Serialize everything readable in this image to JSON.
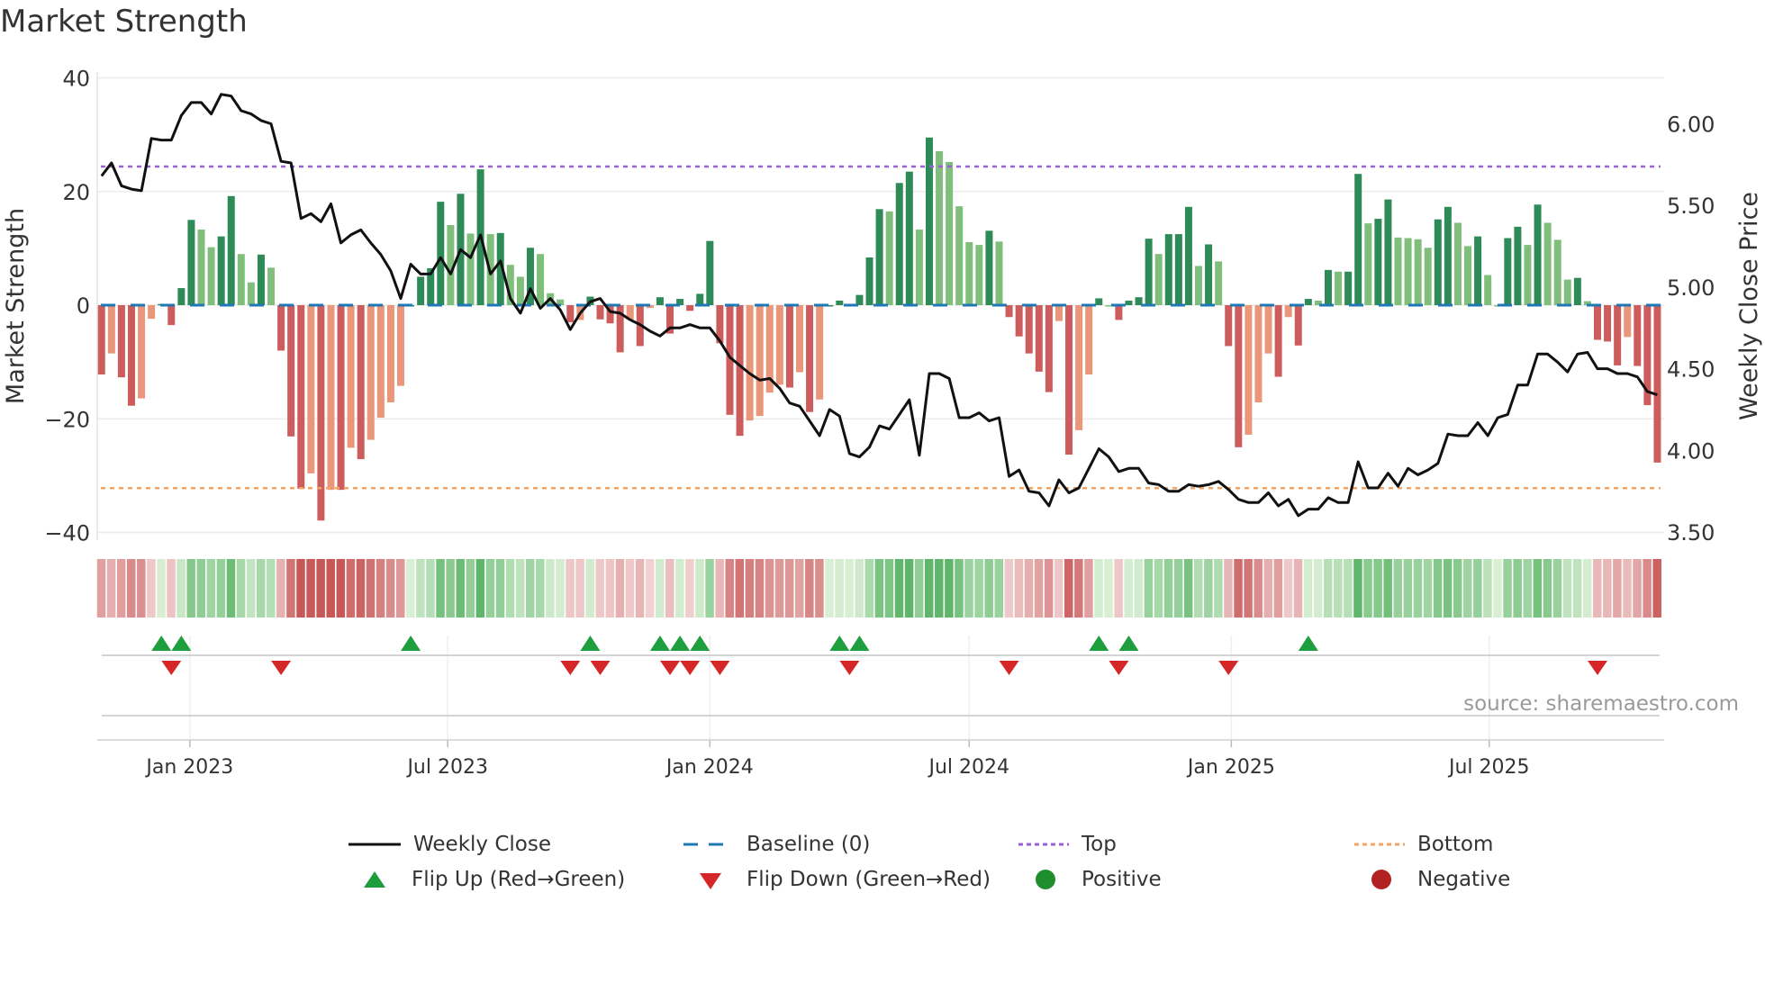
{
  "chart_data": {
    "type": "bar",
    "title": "Market Strength",
    "ylabel_left": "Market Strength",
    "ylabel_right": "Weekly Close Price",
    "ylim_left": [
      -40,
      40
    ],
    "ylim_right": [
      3.5,
      6.0
    ],
    "left_ticks": [
      "40",
      "20",
      "0",
      "−20",
      "−40"
    ],
    "left_tick_values": [
      40,
      20,
      0,
      -20,
      -40
    ],
    "right_ticks": [
      "6.00",
      "5.50",
      "5.00",
      "4.50",
      "4.00",
      "3.50"
    ],
    "right_tick_values": [
      6.0,
      5.5,
      5.0,
      4.5,
      4.0,
      3.5
    ],
    "x_ticks": [
      {
        "label": "Jan 2023",
        "date": "2023-01-01"
      },
      {
        "label": "Jul 2023",
        "date": "2023-07-01"
      },
      {
        "label": "Jan 2024",
        "date": "2024-01-01"
      },
      {
        "label": "Jul 2024",
        "date": "2024-07-01"
      },
      {
        "label": "Jan 2025",
        "date": "2025-01-01"
      },
      {
        "label": "Jul 2025",
        "date": "2025-07-01"
      }
    ],
    "start_date": "2022-10-31",
    "interval_days": 7,
    "top_level": 24.4,
    "bottom_level": -32.2,
    "baseline": 0,
    "strength": [
      -12.2,
      -8.5,
      -12.7,
      -17.7,
      -16.4,
      -2.4,
      0.2,
      -3.5,
      3,
      15,
      13.3,
      10.2,
      12.1,
      19.2,
      9,
      4,
      8.9,
      6.6,
      -8,
      -23.1,
      -32.3,
      -29.6,
      -37.9,
      -32.5,
      -32.5,
      -25.1,
      -27.1,
      -23.7,
      -19.8,
      -17.1,
      -14.2,
      0,
      5,
      6.5,
      18.2,
      14.1,
      19.6,
      12.6,
      23.9,
      12.5,
      12.7,
      7.1,
      5,
      10.1,
      9,
      2.1,
      1,
      -3,
      -2.6,
      1.5,
      -2.5,
      -3.2,
      -8.3,
      -2.5,
      -7.2,
      -0.5,
      1.4,
      -5,
      1.1,
      -1,
      2,
      11.3,
      -6.7,
      -19.3,
      -23,
      -20.3,
      -19.5,
      -15.4,
      -14,
      -14.5,
      -11.8,
      -18.8,
      -16.6,
      0,
      0.8,
      0,
      1.8,
      8.4,
      16.9,
      16.5,
      21.5,
      23.5,
      13.3,
      29.5,
      27.1,
      25.2,
      17.4,
      11.1,
      10.6,
      13.1,
      11.2,
      -2.1,
      -5.5,
      -8.5,
      -11.7,
      -15.3,
      -2.8,
      -26.3,
      -22,
      -12.2,
      1.2,
      0,
      -2.6,
      0.8,
      1.4,
      11.7,
      9,
      12.5,
      12.5,
      17.3,
      6.9,
      10.7,
      7.7,
      -7.2,
      -25,
      -22.8,
      -17.1,
      -8.5,
      -12.6,
      -2.1,
      -7.1,
      1.1,
      0.8,
      6.2,
      5.9,
      5.9,
      23.1,
      14.4,
      15.2,
      18.6,
      11.9,
      11.8,
      11.6,
      10.1,
      15.1,
      17.3,
      14.5,
      10.4,
      12.1,
      5.3,
      0,
      11.8,
      13.8,
      10.6,
      17.7,
      14.5,
      11.5,
      4.5,
      4.8,
      0.7,
      -6.1,
      -6.4,
      -10.6,
      -5.6,
      -10.7,
      -17.6,
      -27.7
    ],
    "weekly_close": [
      5.68,
      5.76,
      5.62,
      5.6,
      5.59,
      5.91,
      5.9,
      5.9,
      6.05,
      6.13,
      6.13,
      6.06,
      6.18,
      6.17,
      6.08,
      6.06,
      6.02,
      6.0,
      5.77,
      5.76,
      5.42,
      5.45,
      5.4,
      5.51,
      5.27,
      5.32,
      5.35,
      5.27,
      5.2,
      5.1,
      4.93,
      5.14,
      5.08,
      5.08,
      5.18,
      5.08,
      5.23,
      5.18,
      5.32,
      5.08,
      5.16,
      4.93,
      4.84,
      4.99,
      4.87,
      4.93,
      4.86,
      4.74,
      4.84,
      4.91,
      4.93,
      4.85,
      4.84,
      4.8,
      4.77,
      4.73,
      4.7,
      4.75,
      4.75,
      4.77,
      4.75,
      4.75,
      4.67,
      4.57,
      4.52,
      4.47,
      4.43,
      4.44,
      4.38,
      4.29,
      4.27,
      4.18,
      4.09,
      4.25,
      4.21,
      3.98,
      3.96,
      4.02,
      4.15,
      4.13,
      4.22,
      4.31,
      3.97,
      4.47,
      4.47,
      4.44,
      4.2,
      4.2,
      4.23,
      4.18,
      4.2,
      3.84,
      3.88,
      3.75,
      3.74,
      3.66,
      3.82,
      3.74,
      3.77,
      3.89,
      4.01,
      3.96,
      3.87,
      3.89,
      3.89,
      3.8,
      3.79,
      3.75,
      3.75,
      3.79,
      3.78,
      3.79,
      3.81,
      3.76,
      3.7,
      3.68,
      3.68,
      3.74,
      3.66,
      3.7,
      3.6,
      3.64,
      3.64,
      3.71,
      3.68,
      3.68,
      3.93,
      3.77,
      3.77,
      3.86,
      3.78,
      3.89,
      3.85,
      3.88,
      3.92,
      4.1,
      4.09,
      4.09,
      4.17,
      4.09,
      4.2,
      4.22,
      4.4,
      4.4,
      4.59,
      4.59,
      4.54,
      4.48,
      4.59,
      4.6,
      4.5,
      4.5,
      4.47,
      4.47,
      4.45,
      4.36,
      4.34
    ],
    "flip_up_dates": [
      "2022-12-12",
      "2022-12-26",
      "2023-06-05",
      "2023-10-09",
      "2023-11-27",
      "2023-12-11",
      "2023-12-25",
      "2024-04-01",
      "2024-04-15",
      "2024-09-30",
      "2024-10-21",
      "2025-02-24"
    ],
    "flip_down_dates": [
      "2022-12-19",
      "2023-03-06",
      "2023-09-25",
      "2023-10-16",
      "2023-12-04",
      "2023-12-18",
      "2024-01-08",
      "2024-04-08",
      "2024-07-29",
      "2024-10-14",
      "2024-12-30",
      "2025-09-15"
    ],
    "colors": {
      "positive_rising": "#2e8b57",
      "positive_falling": "#7fbf7b",
      "negative_falling": "#cd5c5c",
      "negative_rising": "#e9967a",
      "close_line": "#111111",
      "baseline": "#1f77b4",
      "top": "#9b5fd8",
      "bottom": "#f4a460",
      "flip_up": "#1f9e3e",
      "flip_down": "#d62728",
      "positive": "#1f8f2e",
      "negative": "#b22222"
    }
  },
  "legend": {
    "weekly_close": "Weekly Close",
    "baseline": "Baseline (0)",
    "top": "Top",
    "bottom": "Bottom",
    "flip_up": "Flip Up (Red→Green)",
    "flip_down": "Flip Down (Green→Red)",
    "positive": "Positive",
    "negative": "Negative"
  },
  "source": "source: sharemaestro.com"
}
